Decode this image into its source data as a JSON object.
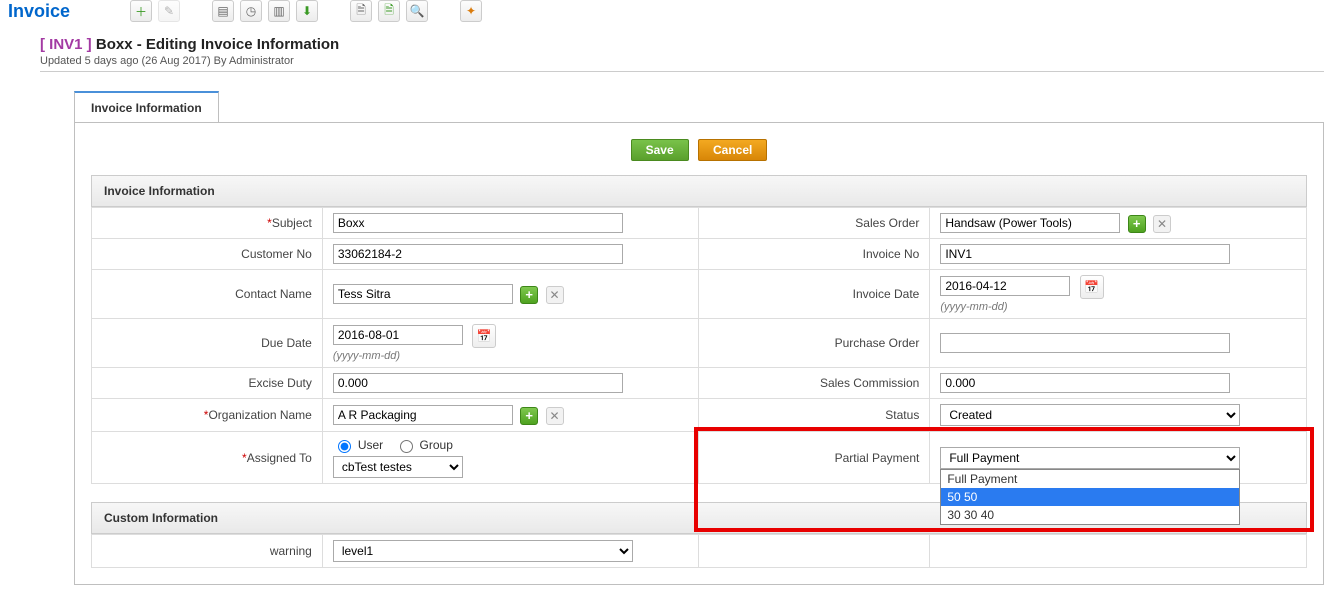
{
  "page_title": "Invoice",
  "record": {
    "code": "[ INV1 ]",
    "title": "Boxx - Editing Invoice Information",
    "meta": "Updated 5 days ago (26 Aug 2017) By Administrator"
  },
  "tabs": {
    "active": "Invoice Information"
  },
  "buttons": {
    "save": "Save",
    "cancel": "Cancel"
  },
  "section1_title": "Invoice Information",
  "section2_title": "Custom Information",
  "labels": {
    "subject": "Subject",
    "sales_order": "Sales Order",
    "customer_no": "Customer No",
    "invoice_no": "Invoice No",
    "contact_name": "Contact Name",
    "invoice_date": "Invoice Date",
    "due_date": "Due Date",
    "purchase_order": "Purchase Order",
    "excise_duty": "Excise Duty",
    "sales_commission": "Sales Commission",
    "org_name": "Organization Name",
    "status": "Status",
    "assigned_to": "Assigned To",
    "partial_payment": "Partial Payment",
    "warning": "warning"
  },
  "values": {
    "subject": "Boxx",
    "sales_order": "Handsaw (Power Tools)",
    "customer_no": "33062184-2",
    "invoice_no": "INV1",
    "contact_name": "Tess Sitra",
    "invoice_date": "2016-04-12",
    "due_date": "2016-08-01",
    "purchase_order": "",
    "excise_duty": "0.000",
    "sales_commission": "0.000",
    "org_name": "A R Packaging",
    "status": "Created",
    "assigned_to_type_user": "User",
    "assigned_to_type_group": "Group",
    "assigned_to": "cbTest testes",
    "partial_payment": "Full Payment",
    "warning": "level1"
  },
  "hints": {
    "date_format": "(yyyy-mm-dd)"
  },
  "partial_payment_options": [
    "Full Payment",
    "50 50",
    "30 30 40"
  ],
  "partial_payment_highlight_index": 1
}
